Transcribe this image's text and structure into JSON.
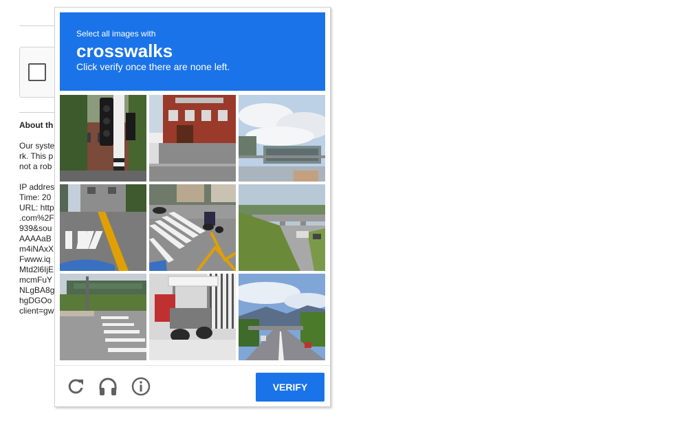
{
  "background": {
    "about_heading": "About th",
    "paragraph_lines": [
      "Our syste",
      "rk. This p",
      "not a rob"
    ],
    "info_lines": [
      "IP addres",
      "Time: 20",
      "URL: http",
      ".com%2F",
      "939&sou",
      "AAAAaB",
      "m4iNAxX",
      "Fwww.iq",
      "Mtd2l6IjE",
      "mcmFuY",
      "NLgBA8g",
      "hgDGOo",
      "client=gw"
    ]
  },
  "challenge": {
    "instruction_small": "Select all images with",
    "target": "crosswalks",
    "instruction_sub": "Click verify once there are none left.",
    "tiles": [
      {
        "label": "traffic light pole by brick building"
      },
      {
        "label": "red brick building with driveway"
      },
      {
        "label": "highway overhead signs under cloudy sky"
      },
      {
        "label": "street with zebra crosswalk"
      },
      {
        "label": "motorcyclist on crosswalk"
      },
      {
        "label": "highway overpass with grassy slope"
      },
      {
        "label": "crosswalk near building"
      },
      {
        "label": "motorcycle parked by sidewalk"
      },
      {
        "label": "road with mountains in distance"
      }
    ],
    "verify_label": "VERIFY",
    "icons": [
      "reload-icon",
      "headphones-icon",
      "info-icon"
    ]
  },
  "colors": {
    "accent": "#1a73e8"
  }
}
